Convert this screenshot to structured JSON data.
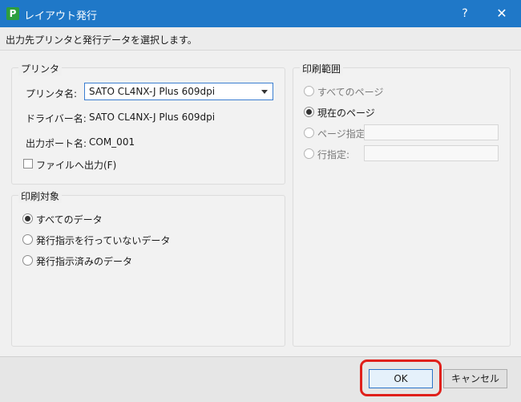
{
  "window": {
    "app_icon": "P",
    "title": "レイアウト発行",
    "help": "?",
    "close": "✕"
  },
  "instruction": "出力先プリンタと発行データを選択します。",
  "printer_group": {
    "title": "プリンタ",
    "printer_label": "プリンタ名:",
    "printer_value": "SATO CL4NX-J Plus 609dpi",
    "driver_label": "ドライバー名:",
    "driver_value": "SATO CL4NX-J Plus 609dpi",
    "port_label": "出力ポート名:",
    "port_value": "COM_001",
    "file_output_label": "ファイルへ出力(F)",
    "file_output_checked": false
  },
  "target_group": {
    "title": "印刷対象",
    "options": [
      {
        "label": "すべてのデータ",
        "checked": true
      },
      {
        "label": "発行指示を行っていないデータ",
        "checked": false
      },
      {
        "label": "発行指示済みのデータ",
        "checked": false
      }
    ]
  },
  "range_group": {
    "title": "印刷範囲",
    "options": [
      {
        "label": "すべてのページ",
        "checked": false
      },
      {
        "label": "現在のページ",
        "checked": true
      },
      {
        "label": "ページ指定:",
        "checked": false
      },
      {
        "label": "行指定:",
        "checked": false
      }
    ],
    "page_value": "",
    "row_value": ""
  },
  "buttons": {
    "ok": "OK",
    "cancel": "キャンセル"
  },
  "colors": {
    "titlebar": "#1f78c8",
    "highlight": "#e0201b"
  }
}
